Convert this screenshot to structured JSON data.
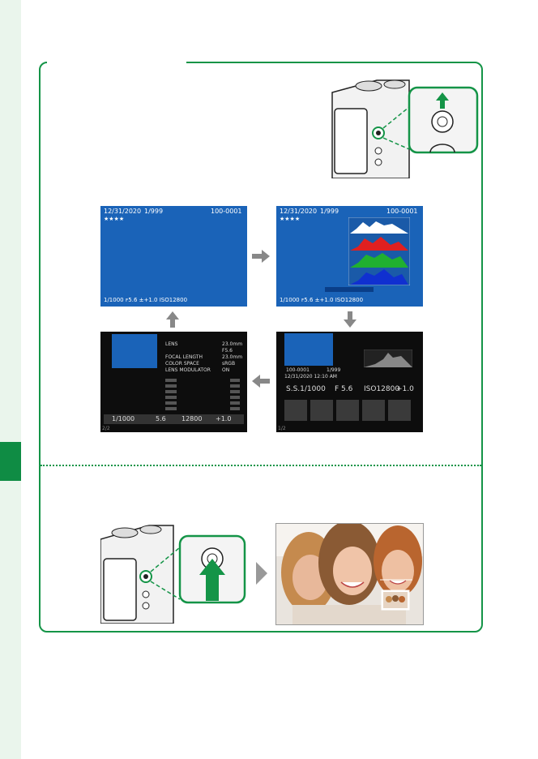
{
  "colors": {
    "accent": "#149447",
    "screen_blue": "#1a63b8"
  },
  "screen1": {
    "date": "12/31/2020",
    "frame": "1/999",
    "file": "100-0001",
    "stars": "★★★★",
    "status": "1/1000  ꜰ5.6  ±+1.0  ISO12800"
  },
  "screen2": {
    "date": "12/31/2020",
    "frame": "1/999",
    "file": "100-0001",
    "stars": "★★★★",
    "status": "1/1000  ꜰ5.6  ±+1.0  ISO12800"
  },
  "screen3": {
    "labels": [
      "LENS",
      "FOCAL LENGTH",
      "COLOR SPACE",
      "LENS MODULATOR"
    ],
    "values": [
      "23.0mm",
      "F5.6",
      "23.0mm",
      "sRGB",
      "ON"
    ],
    "unit": "ᴍᴍ",
    "bottom": [
      "1/1000",
      "5.6",
      "12800",
      "+1.0"
    ],
    "page": "2/2"
  },
  "screen4": {
    "file": "100-0001",
    "frame": "1/999",
    "datetime": "12/31/2020 12:10 AM",
    "exposure": [
      "S.S.1/1000",
      "F 5.6",
      "ISO12800",
      "+1.0"
    ],
    "page": "1/2"
  },
  "icons": [
    "arrow-right-icon",
    "arrow-down-icon",
    "arrow-left-icon",
    "arrow-up-icon",
    "arrow-right-icon"
  ]
}
